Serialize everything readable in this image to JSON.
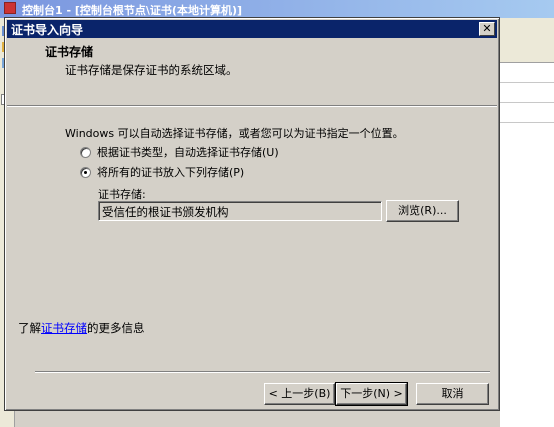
{
  "background_window": {
    "title": "控制台1 - [控制台根节点\\证书(本地计算机)]"
  },
  "dialog": {
    "title": "证书导入向导",
    "close_label": "✕",
    "header": {
      "title": "证书存储",
      "subtitle": "证书存储是保存证书的系统区域。"
    },
    "intro": "Windows 可以自动选择证书存储，或者您可以为证书指定一个位置。",
    "options": [
      {
        "label": "根据证书类型，自动选择证书存储(U)",
        "checked": false
      },
      {
        "label": "将所有的证书放入下列存储(P)",
        "checked": true
      }
    ],
    "store_field": {
      "label": "证书存储:",
      "value": "受信任的根证书颁发机构"
    },
    "browse_label": "浏览(R)...",
    "learn_more": {
      "prefix": "了解",
      "link": "证书存储",
      "suffix": "的更多信息"
    },
    "buttons": {
      "back": "< 上一步(B)",
      "next": "下一步(N) >",
      "cancel": "取消"
    }
  }
}
